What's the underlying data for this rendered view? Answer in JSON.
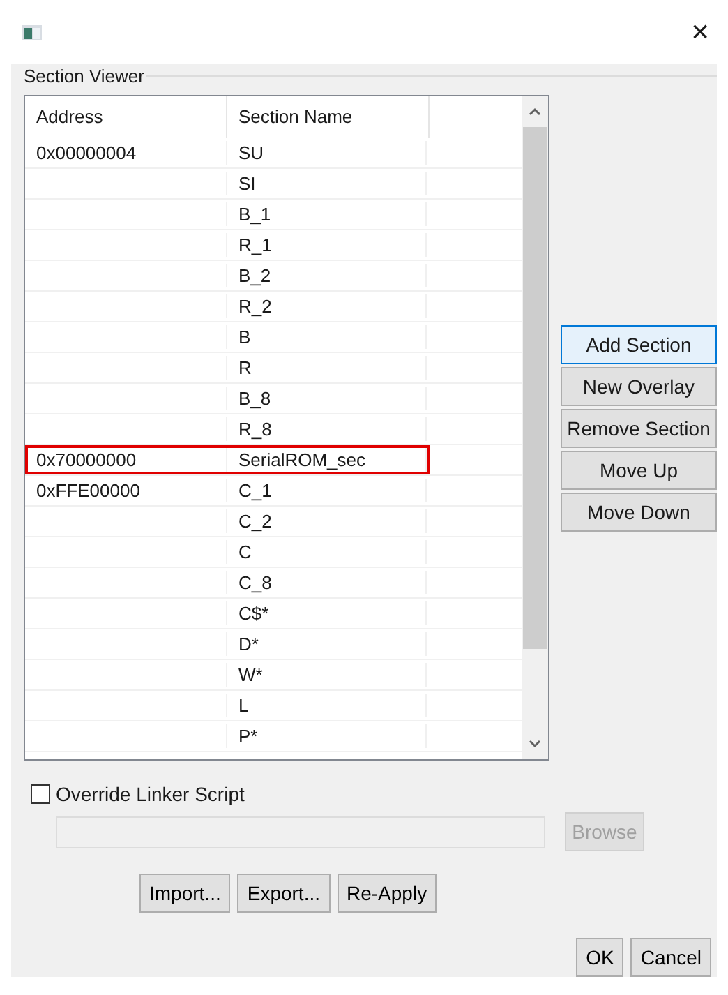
{
  "window": {
    "close": "×"
  },
  "group": {
    "title": "Section Viewer"
  },
  "table": {
    "columns": [
      "Address",
      "Section Name"
    ],
    "rows": [
      {
        "address": "0x00000004",
        "name": "SU",
        "highlighted": false
      },
      {
        "address": "",
        "name": "SI",
        "highlighted": false
      },
      {
        "address": "",
        "name": "B_1",
        "highlighted": false
      },
      {
        "address": "",
        "name": "R_1",
        "highlighted": false
      },
      {
        "address": "",
        "name": "B_2",
        "highlighted": false
      },
      {
        "address": "",
        "name": "R_2",
        "highlighted": false
      },
      {
        "address": "",
        "name": "B",
        "highlighted": false
      },
      {
        "address": "",
        "name": "R",
        "highlighted": false
      },
      {
        "address": "",
        "name": "B_8",
        "highlighted": false
      },
      {
        "address": "",
        "name": "R_8",
        "highlighted": false
      },
      {
        "address": "0x70000000",
        "name": "SerialROM_sec",
        "highlighted": true
      },
      {
        "address": "0xFFE00000",
        "name": "C_1",
        "highlighted": false
      },
      {
        "address": "",
        "name": "C_2",
        "highlighted": false
      },
      {
        "address": "",
        "name": "C",
        "highlighted": false
      },
      {
        "address": "",
        "name": "C_8",
        "highlighted": false
      },
      {
        "address": "",
        "name": "C$*",
        "highlighted": false
      },
      {
        "address": "",
        "name": "D*",
        "highlighted": false
      },
      {
        "address": "",
        "name": "W*",
        "highlighted": false
      },
      {
        "address": "",
        "name": "L",
        "highlighted": false
      },
      {
        "address": "",
        "name": "P*",
        "highlighted": false
      }
    ]
  },
  "side_buttons": [
    {
      "label": "Add Section",
      "selected": true
    },
    {
      "label": "New Overlay",
      "selected": false
    },
    {
      "label": "Remove Section",
      "selected": false
    },
    {
      "label": "Move Up",
      "selected": false
    },
    {
      "label": "Move Down",
      "selected": false
    }
  ],
  "override": {
    "label": "Override Linker Script",
    "checked": false
  },
  "path_field": {
    "disabled": true
  },
  "browse_button": {
    "label": "Browse",
    "disabled": true
  },
  "action_buttons": [
    "Import...",
    "Export...",
    "Re-Apply"
  ],
  "dialog_buttons": [
    "OK",
    "Cancel"
  ]
}
